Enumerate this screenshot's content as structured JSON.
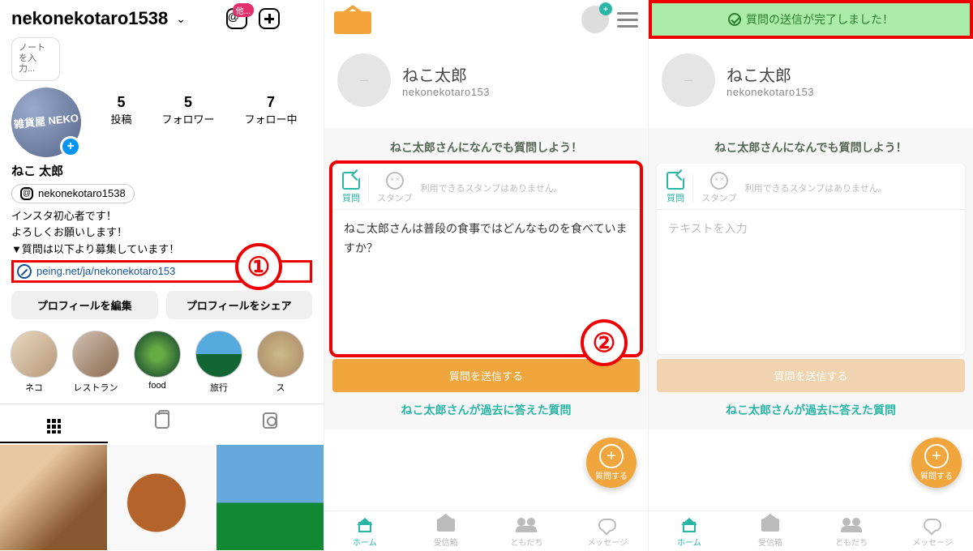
{
  "instagram": {
    "username": "nekonekotaro1538",
    "threads_badge": "他...",
    "note_placeholder": "ノートを入力...",
    "avatar_text": "雑貨屋 NEKO",
    "stats": {
      "posts_n": "5",
      "posts_l": "投稿",
      "followers_n": "5",
      "followers_l": "フォロワー",
      "following_n": "7",
      "following_l": "フォロー中"
    },
    "display_name": "ねこ 太郎",
    "threads_handle": "nekonekotaro1538",
    "bio_line1": "インスタ初心者です！",
    "bio_line2": "よろしくお願いします！",
    "bio_line3": "▼質問は以下より募集しています！",
    "bio_link": "peing.net/ja/nekonekotaro153",
    "btn_edit": "プロフィールを編集",
    "btn_share": "プロフィールをシェア",
    "highlights": [
      "ネコ",
      "レストラン",
      "food",
      "旅行",
      "ス"
    ]
  },
  "callouts": {
    "one": "①",
    "two": "②"
  },
  "peing": {
    "success_msg": "質問の送信が完了しました！",
    "profile_name": "ねこ太郎",
    "profile_handle": "nekonekotaro153",
    "prompt": "ねこ太郎さんになんでも質問しよう！",
    "tab_question": "質問",
    "tab_stamp": "スタンプ",
    "stamp_unavailable": "利用できるスタンプはありません。",
    "entered_question": "ねこ太郎さんは普段の食事ではどんなものを食べていますか？",
    "textarea_placeholder": "テキストを入力",
    "send_label": "質問を送信する",
    "fab_label": "質問する",
    "past_questions": "ねこ太郎さんが過去に答えた質問",
    "nav": {
      "home": "ホーム",
      "inbox": "受信箱",
      "friends": "ともだち",
      "messages": "メッセージ"
    }
  }
}
